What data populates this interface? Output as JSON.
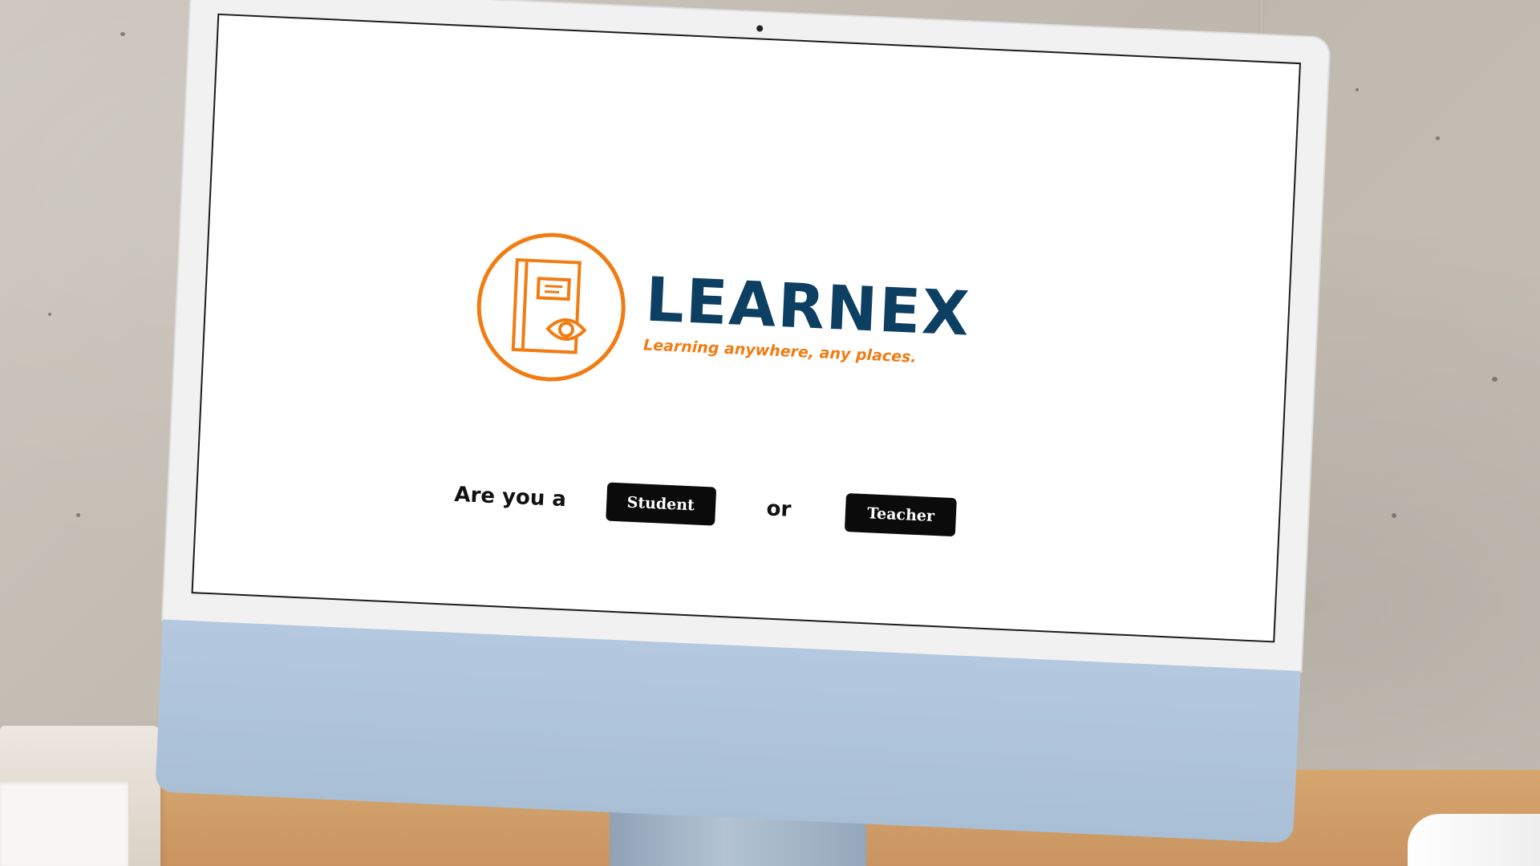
{
  "app": {
    "brand_name": "LEARNEX",
    "tagline": "Learning anywhere, any places.",
    "colors": {
      "brand_navy": "#0d3f62",
      "brand_orange": "#f07c12",
      "button_bg": "#0b0b0b",
      "button_text": "#ffffff",
      "screen_bg": "#ffffff"
    },
    "logo_icon": "book-eye-icon"
  },
  "role_prompt": {
    "prefix": "Are you a",
    "student_label": "Student",
    "connector": "or",
    "teacher_label": "Teacher"
  }
}
